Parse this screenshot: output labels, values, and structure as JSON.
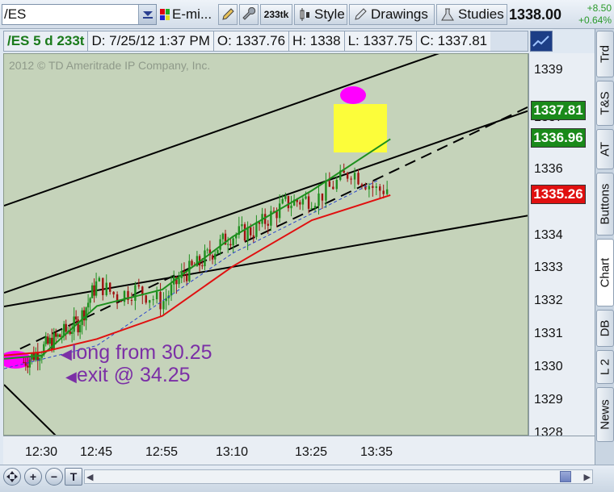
{
  "toolbar": {
    "symbol": "/ES",
    "link_label": "E-mi...",
    "aggregation": "233tk",
    "style_label": "Style",
    "drawings_label": "Drawings",
    "studies_label": "Studies",
    "last_price": "1338.00",
    "net_change": "+8.50",
    "pct_change": "+0.64%"
  },
  "infobar": {
    "symbol_period": "/ES 5 d 233t",
    "datetime": "D: 7/25/12 1:37 PM",
    "open": "O: 1337.76",
    "high": "H: 1338",
    "low": "L: 1337.75",
    "close": "C: 1337.81"
  },
  "chart": {
    "watermark": "2012 © TD Ameritrade IP Company, Inc.",
    "annotation_entry": "long from 30.25",
    "annotation_exit": "exit @ 34.25",
    "price_ticks": [
      "1339",
      "1337",
      "1336",
      "1335",
      "1334",
      "1333",
      "1332",
      "1331",
      "1330",
      "1329",
      "1328"
    ],
    "time_ticks": [
      "12:30",
      "12:45",
      "12:55",
      "13:10",
      "13:25",
      "13:35"
    ],
    "badges": {
      "last": "1337.81",
      "green_ma": "1336.96",
      "red_ma": "1335.26"
    },
    "colors": {
      "background": "#c5d3ba",
      "up_candle": "#1f8f1f",
      "down_candle": "#a01010",
      "fast_ma": "#1d8f1d",
      "slow_ma": "#e01010",
      "trend_lines": "#000000",
      "dashed_blue": "#2a44cc",
      "highlight": "#ffff33",
      "marker": "#ff00ff",
      "annotation": "#7b2fa6"
    }
  },
  "chart_data": {
    "type": "line",
    "title": "",
    "xlabel": "",
    "ylabel": "",
    "ylim": [
      1328,
      1339.5
    ],
    "x": [
      "12:30",
      "12:45",
      "12:55",
      "13:10",
      "13:25",
      "13:35"
    ],
    "series": [
      {
        "values": [
          1330.2,
          1332.6,
          1332.3,
          1334.4,
          1335.6,
          1337.8
        ]
      },
      {
        "values": [
          1330.4,
          1331.9,
          1332.4,
          1334.0,
          1335.4,
          1336.96
        ]
      },
      {
        "values": [
          1330.5,
          1330.9,
          1331.6,
          1333.1,
          1334.5,
          1335.26
        ]
      }
    ]
  },
  "right_tabs": [
    "Trd",
    "T&S",
    "AT",
    "Buttons",
    "Chart",
    "DB",
    "L 2",
    "News"
  ],
  "bottombar": {
    "zoom_in_label": "+",
    "zoom_out_label": "−",
    "text_tool_label": "T"
  }
}
